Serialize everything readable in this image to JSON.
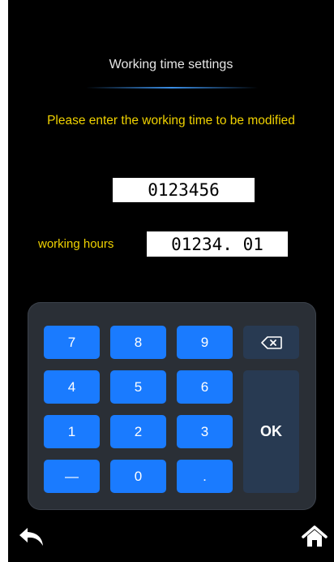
{
  "header": {
    "title": "Working time settings",
    "prompt": "Please enter the working time to be modified"
  },
  "form": {
    "id_value": "0123456",
    "hours_label": "working hours",
    "hours_value": "01234. 01"
  },
  "keypad": {
    "keys": {
      "k7": "7",
      "k8": "8",
      "k9": "9",
      "k4": "4",
      "k5": "5",
      "k6": "6",
      "k1": "1",
      "k2": "2",
      "k3": "3",
      "minus": "—",
      "k0": "0",
      "dot": ".",
      "ok": "OK"
    },
    "backspace_icon": "backspace-icon"
  },
  "nav": {
    "back_icon": "back-arrow-icon",
    "home_icon": "home-icon"
  },
  "colors": {
    "background": "#000000",
    "accent_yellow": "#f0d200",
    "key_blue": "#1a7bff",
    "key_dark": "#283a52",
    "panel": "#2a2f36"
  }
}
